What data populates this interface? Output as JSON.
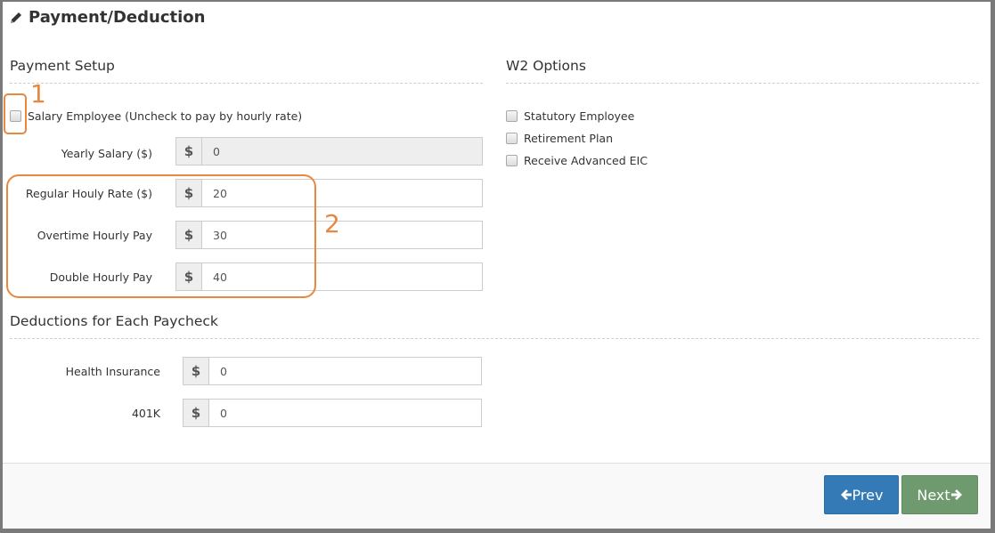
{
  "page": {
    "title": "Payment/Deduction",
    "title_icon": "pencil-icon"
  },
  "payment_setup": {
    "heading": "Payment Setup",
    "salary_checkbox": {
      "label": "Salary Employee (Uncheck to pay by hourly rate)",
      "checked": false
    },
    "yearly_salary": {
      "label": "Yearly Salary ($)",
      "addon": "$",
      "value": "0",
      "disabled": true
    },
    "hourly_fields": [
      {
        "label": "Regular Houly Rate ($)",
        "addon": "$",
        "value": "20"
      },
      {
        "label": "Overtime Hourly Pay",
        "addon": "$",
        "value": "30"
      },
      {
        "label": "Double Hourly Pay",
        "addon": "$",
        "value": "40"
      }
    ]
  },
  "w2_options": {
    "heading": "W2 Options",
    "items": [
      {
        "label": "Statutory Employee",
        "checked": false
      },
      {
        "label": "Retirement Plan",
        "checked": false
      },
      {
        "label": "Receive Advanced EIC",
        "checked": false
      }
    ]
  },
  "deductions": {
    "heading": "Deductions for Each Paycheck",
    "fields": [
      {
        "label": "Health Insurance",
        "addon": "$",
        "value": "0"
      },
      {
        "label": "401K",
        "addon": "$",
        "value": "0"
      }
    ]
  },
  "annotations": {
    "one": "1",
    "two": "2",
    "color": "#e8883f"
  },
  "footer": {
    "prev_label": "Prev",
    "next_label": "Next",
    "prev_color": "#337ab7",
    "next_color": "#6f9a6f"
  }
}
